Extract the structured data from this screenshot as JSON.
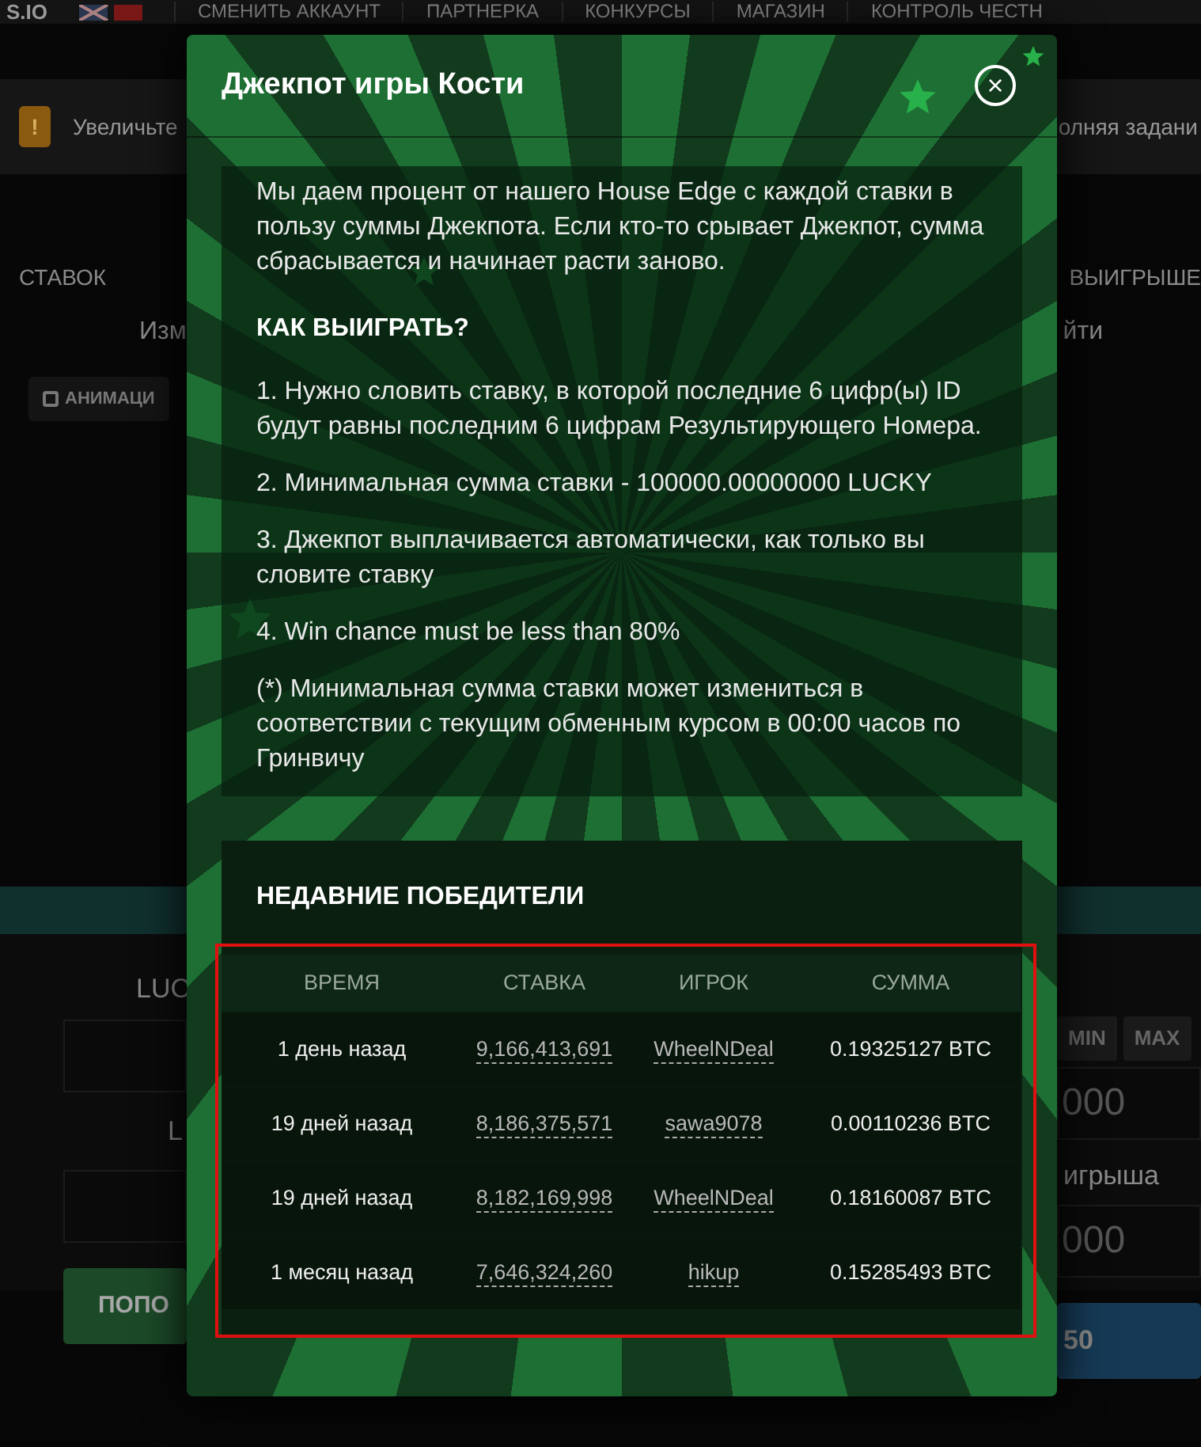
{
  "background": {
    "logo": "S.IO",
    "nav": [
      "СМЕНИТЬ АККАУНТ",
      "ПАРТНЕРКА",
      "КОНКУРСЫ",
      "МАГАЗИН",
      "КОНТРОЛЬ ЧЕСТН"
    ],
    "alert": {
      "icon": "!",
      "text_left": "Увеличьте",
      "text_right": "олняя задани"
    },
    "heading_left": "СТАВОК",
    "heading_right": "ВЫИГРЫШЕ",
    "link_left": "Изм",
    "link_right": "йти",
    "animation_toggle": {
      "label": "АНИМАЦИ",
      "checked": false
    },
    "bet_label": "LUC",
    "min_button": "MIN",
    "max_button": "MAX",
    "bet_value": "000",
    "payout_label": "L",
    "payout_label_right": "игрыша",
    "payout_value": "000",
    "roll_button": "ПОПО",
    "right_button": "50"
  },
  "modal": {
    "title": "Джекпот игры Кости",
    "close": "×",
    "intro": "Мы даем процент от нашего House Edge с каждой ставки в пользу суммы Джекпота. Если кто-то срывает Джекпот, сумма сбрасывается и начинает расти заново.",
    "how_heading": "КАК ВЫИГРАТЬ?",
    "rules": [
      "1. Нужно словить ставку, в которой последние 6 цифр(ы) ID будут равны последним 6 цифрам Результирующего Номера.",
      "2. Минимальная сумма ставки - 100000.00000000 LUCKY",
      "3. Джекпот выплачивается автоматически, как только вы словите ставку",
      "4. Win chance must be less than 80%",
      "(*) Минимальная сумма ставки может измениться в соответствии с текущим обменным курсом в 00:00 часов по Гринвичу"
    ],
    "winners_heading": "НЕДАВНИЕ ПОБЕДИТЕЛИ",
    "columns": [
      "ВРЕМЯ",
      "СТАВКА",
      "ИГРОК",
      "СУММА"
    ],
    "rows": [
      {
        "time": "1 день назад",
        "bet": "9,166,413,691",
        "player": "WheelNDeal",
        "amount": "0.19325127 BTC"
      },
      {
        "time": "19 дней назад",
        "bet": "8,186,375,571",
        "player": "sawa9078",
        "amount": "0.00110236 BTC"
      },
      {
        "time": "19 дней назад",
        "bet": "8,182,169,998",
        "player": "WheelNDeal",
        "amount": "0.18160087 BTC"
      },
      {
        "time": "1 месяц назад",
        "bet": "7,646,324,260",
        "player": "hikup",
        "amount": "0.15285493 BTC"
      }
    ]
  }
}
